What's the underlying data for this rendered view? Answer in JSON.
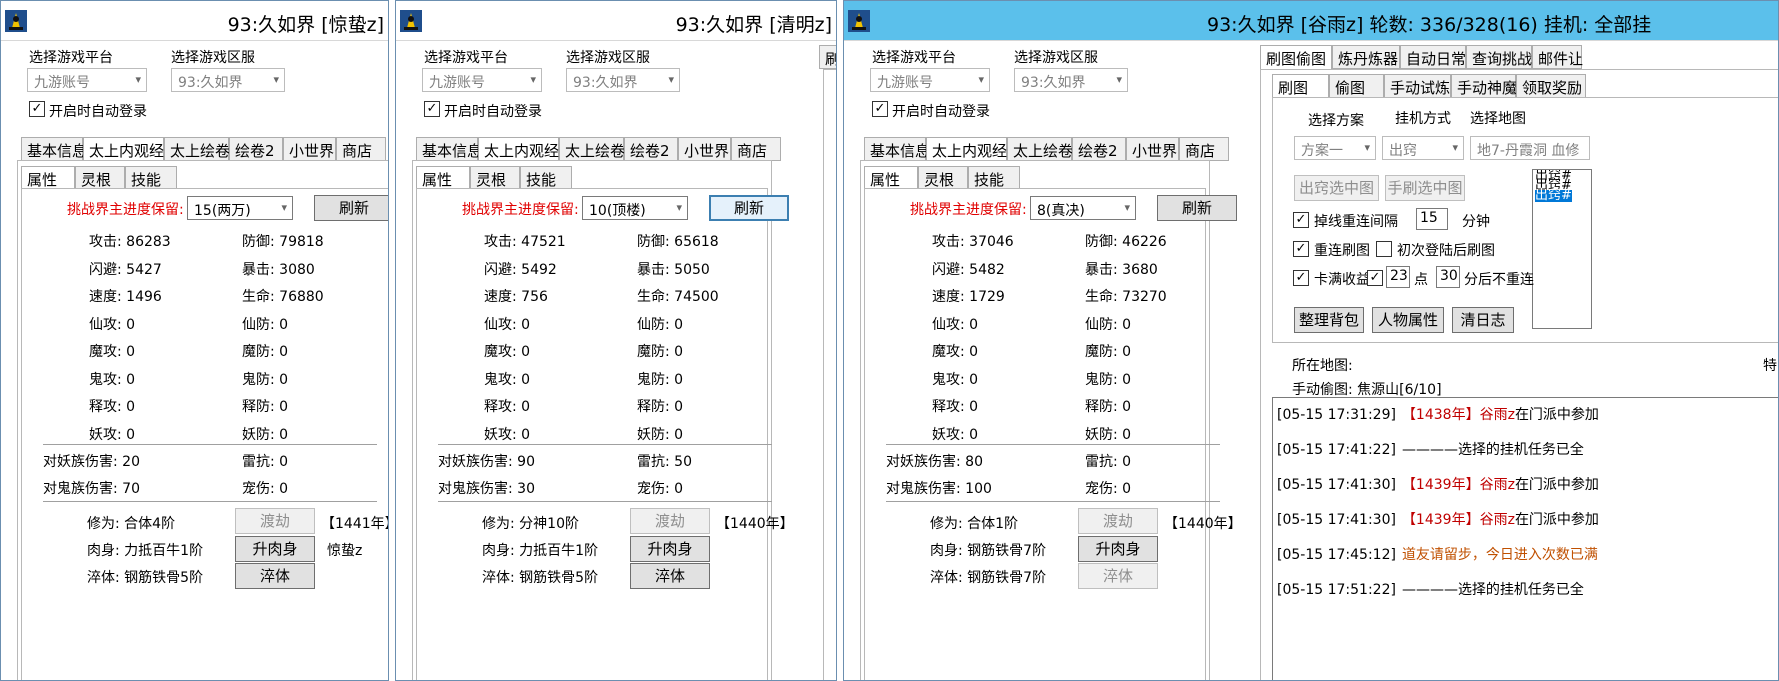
{
  "windows": [
    {
      "title": "93:久如界 [惊蛰z]",
      "platform_label": "选择游戏平台",
      "platform_value": "九游账号",
      "server_label": "选择游戏区服",
      "server_value": "93:久如界",
      "auto_login": "开启时自动登录",
      "tabs": [
        "基本信息",
        "太上内观经",
        "太上绘卷",
        "绘卷2",
        "小世界",
        "商店"
      ],
      "subtabs": [
        "属性",
        "灵根",
        "技能"
      ],
      "challenge_label": "挑战界主进度保留:",
      "challenge_value": "15(两万)",
      "refresh": "刷新",
      "stats": [
        [
          "攻击: 86283",
          "防御: 79818"
        ],
        [
          "闪避: 5427",
          "暴击: 3080"
        ],
        [
          "速度: 1496",
          "生命: 76880"
        ],
        [
          "仙攻: 0",
          "仙防: 0"
        ],
        [
          "魔攻: 0",
          "魔防: 0"
        ],
        [
          "鬼攻: 0",
          "鬼防: 0"
        ],
        [
          "释攻: 0",
          "释防: 0"
        ],
        [
          "妖攻: 0",
          "妖防: 0"
        ]
      ],
      "dmg": [
        [
          "对妖族伤害: 20",
          "雷抗: 0"
        ],
        [
          "对鬼族伤害: 70",
          "宠伤: 0"
        ]
      ],
      "cultivation": "修为: 合体4阶",
      "tribulation": "渡劫",
      "year": "【1441年】",
      "body": "肉身: 力抵百牛1阶",
      "body_btn": "升肉身",
      "extra": "惊蛰z",
      "temper": "淬体: 钢筋铁骨5阶",
      "temper_btn": "淬体"
    },
    {
      "title": "93:久如界 [清明z]",
      "platform_label": "选择游戏平台",
      "platform_value": "九游账号",
      "server_label": "选择游戏区服",
      "server_value": "93:久如界",
      "auto_login": "开启时自动登录",
      "tabs": [
        "基本信息",
        "太上内观经",
        "太上绘卷",
        "绘卷2",
        "小世界",
        "商店"
      ],
      "subtabs": [
        "属性",
        "灵根",
        "技能"
      ],
      "challenge_label": "挑战界主进度保留:",
      "challenge_value": "10(顶楼)",
      "refresh": "刷新",
      "stats": [
        [
          "攻击: 47521",
          "防御: 65618"
        ],
        [
          "闪避: 5492",
          "暴击: 5050"
        ],
        [
          "速度: 756",
          "生命: 74500"
        ],
        [
          "仙攻: 0",
          "仙防: 0"
        ],
        [
          "魔攻: 0",
          "魔防: 0"
        ],
        [
          "鬼攻: 0",
          "鬼防: 0"
        ],
        [
          "释攻: 0",
          "释防: 0"
        ],
        [
          "妖攻: 0",
          "妖防: 0"
        ]
      ],
      "dmg": [
        [
          "对妖族伤害: 90",
          "雷抗: 50"
        ],
        [
          "对鬼族伤害: 30",
          "宠伤: 0"
        ]
      ],
      "cultivation": "修为: 分神10阶",
      "tribulation": "渡劫",
      "year": "【1440年】",
      "body": "肉身: 力抵百牛1阶",
      "body_btn": "升肉身",
      "extra": "",
      "temper": "淬体: 钢筋铁骨5阶",
      "temper_btn": "淬体",
      "side_tab": "刷"
    },
    {
      "title": "93:久如界 [谷雨z] 轮数: 336/328(16) 挂机: 全部挂",
      "platform_label": "选择游戏平台",
      "platform_value": "九游账号",
      "server_label": "选择游戏区服",
      "server_value": "93:久如界",
      "auto_login": "开启时自动登录",
      "tabs": [
        "基本信息",
        "太上内观经",
        "太上绘卷",
        "绘卷2",
        "小世界",
        "商店"
      ],
      "subtabs": [
        "属性",
        "灵根",
        "技能"
      ],
      "challenge_label": "挑战界主进度保留:",
      "challenge_value": "8(真决)",
      "refresh": "刷新",
      "stats": [
        [
          "攻击: 37046",
          "防御: 46226"
        ],
        [
          "闪避: 5482",
          "暴击: 3680"
        ],
        [
          "速度: 1729",
          "生命: 73270"
        ],
        [
          "仙攻: 0",
          "仙防: 0"
        ],
        [
          "魔攻: 0",
          "魔防: 0"
        ],
        [
          "鬼攻: 0",
          "鬼防: 0"
        ],
        [
          "释攻: 0",
          "释防: 0"
        ],
        [
          "妖攻: 0",
          "妖防: 0"
        ]
      ],
      "dmg": [
        [
          "对妖族伤害: 80",
          "雷抗: 0"
        ],
        [
          "对鬼族伤害: 100",
          "宠伤: 0"
        ]
      ],
      "cultivation": "修为: 合体1阶",
      "tribulation": "渡劫",
      "year": "【1440年】",
      "body": "肉身: 钢筋铁骨7阶",
      "body_btn": "升肉身",
      "extra": "",
      "temper": "淬体: 钢筋铁骨7阶",
      "temper_btn": "淬体"
    }
  ],
  "right_panel": {
    "tabs": [
      "刷图偷图",
      "炼丹炼器",
      "自动日常",
      "查询挑战",
      "邮件让"
    ],
    "subtabs": [
      "刷图",
      "偷图",
      "手动试炼",
      "手动神魔",
      "领取奖励"
    ],
    "scheme_label": "选择方案",
    "scheme_value": "方案一",
    "mode_label": "挂机方式",
    "mode_value": "出窍",
    "map_label": "选择地图",
    "map_value": "地7-丹霞洞 血修",
    "btn_chuqiao": "出窍选中图",
    "btn_manual": "手刷选中图",
    "reconnect_interval": "掉线重连间隔",
    "interval_value": "15",
    "minutes": "分钟",
    "reconnect_map": "重连刷图",
    "first_login": "初次登陆后刷图",
    "card_full": "卡满收益",
    "hour_value": "23",
    "point": "点",
    "minute_value": "30",
    "no_reconnect": "分后不重连",
    "btn_bag": "整理背包",
    "btn_char": "人物属性",
    "btn_log": "清日志",
    "current_map": "所在地图:",
    "special": "特",
    "manual_steal": "手动偷图: 焦源山[6/10]",
    "list_items": [
      "出窍#",
      "出窍#",
      "出窍#"
    ],
    "logs": [
      {
        "time": "[05-15 17:31:29]",
        "year": "【1438年】",
        "name": "谷雨z",
        "rest": "在门派中参加",
        "type": "name"
      },
      {
        "time": "[05-15 17:41:22]",
        "rest": "————选择的挂机任务已全",
        "type": "plain"
      },
      {
        "time": "[05-15 17:41:30]",
        "year": "【1439年】",
        "name": "谷雨z",
        "rest": "在门派中参加",
        "type": "name"
      },
      {
        "time": "[05-15 17:41:30]",
        "year": "【1439年】",
        "name": "谷雨z",
        "rest": "在门派中参加",
        "type": "name"
      },
      {
        "time": "[05-15 17:45:12]",
        "rest": "道友请留步，今日进入次数已满",
        "type": "orange"
      },
      {
        "time": "[05-15 17:51:22]",
        "rest": "————选择的挂机任务已全",
        "type": "plain"
      }
    ]
  }
}
